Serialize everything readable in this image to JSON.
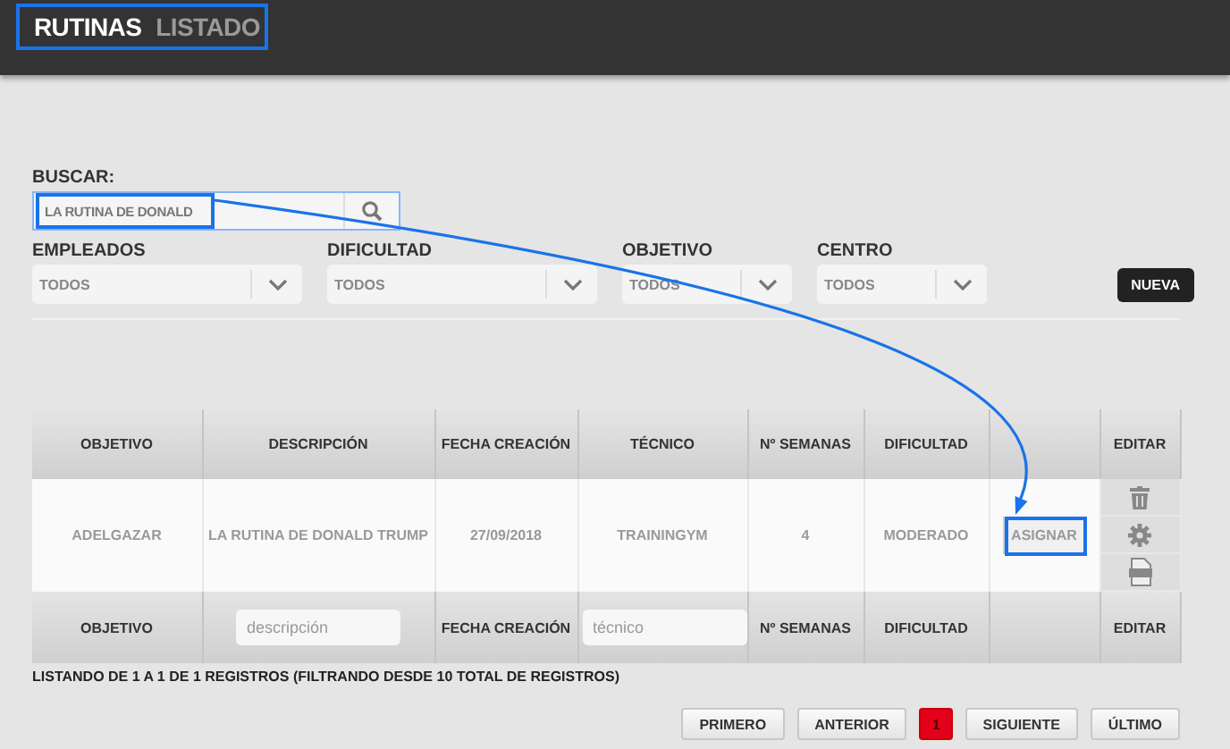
{
  "header": {
    "section": "RUTINAS",
    "page": "LISTADO"
  },
  "search": {
    "label": "BUSCAR:",
    "value": "LA RUTINA DE DONALD"
  },
  "filters": [
    {
      "label": "EMPLEADOS",
      "value": "TODOS"
    },
    {
      "label": "DIFICULTAD",
      "value": "TODOS"
    },
    {
      "label": "OBJETIVO",
      "value": "TODOS"
    },
    {
      "label": "CENTRO",
      "value": "TODOS"
    }
  ],
  "new_button": "NUEVA",
  "table": {
    "columns": [
      {
        "kind": "text",
        "label": "OBJETIVO"
      },
      {
        "kind": "text",
        "label": "DESCRIPCIÓN"
      },
      {
        "kind": "text",
        "label": "FECHA CREACIÓN"
      },
      {
        "kind": "text",
        "label": "TÉCNICO"
      },
      {
        "kind": "text",
        "label": "Nº SEMANAS"
      },
      {
        "kind": "text",
        "label": "DIFICULTAD"
      },
      {
        "kind": "empty"
      },
      {
        "kind": "text",
        "label": "EDITAR"
      }
    ],
    "rows": [
      {
        "cells": [
          "ADELGAZAR",
          "LA RUTINA DE DONALD TRUMP",
          "27/09/2018",
          "TRAININGYM",
          "4",
          "MODERADO"
        ],
        "action": "ASIGNAR"
      }
    ],
    "footer": [
      {
        "kind": "label",
        "text": "OBJETIVO"
      },
      {
        "kind": "input",
        "placeholder": "descripción"
      },
      {
        "kind": "label",
        "text": "FECHA CREACIÓN"
      },
      {
        "kind": "input",
        "placeholder": "técnico"
      },
      {
        "kind": "label",
        "text": "Nº SEMANAS"
      },
      {
        "kind": "label",
        "text": "DIFICULTAD"
      },
      {
        "kind": "empty"
      },
      {
        "kind": "label",
        "text": "EDITAR"
      }
    ]
  },
  "status": "LISTANDO DE 1 A 1 DE 1 REGISTROS (FILTRANDO DESDE 10 TOTAL DE REGISTROS)",
  "pagination": [
    {
      "label": "PRIMERO",
      "selected": false
    },
    {
      "label": "ANTERIOR",
      "selected": false
    },
    {
      "label": "1",
      "selected": true
    },
    {
      "label": "SIGUIENTE",
      "selected": false
    },
    {
      "label": "ÚLTIMO",
      "selected": false
    }
  ]
}
